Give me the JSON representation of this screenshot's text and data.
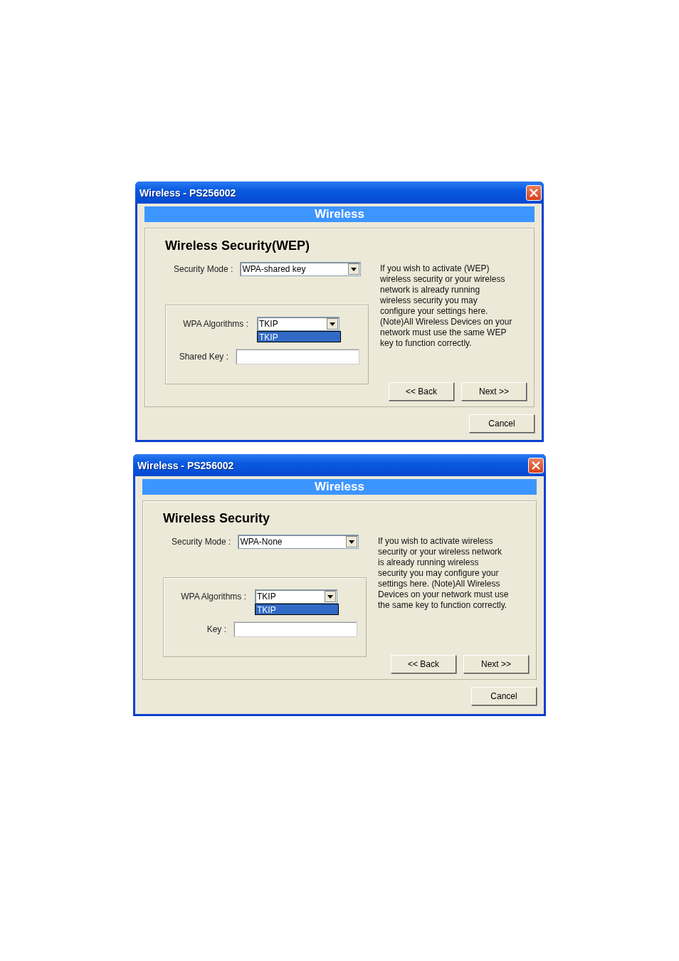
{
  "dialogs": [
    {
      "window": {
        "title": "Wireless - PS256002"
      },
      "banner": "Wireless",
      "heading": "Wireless Security(WEP)",
      "security_mode": {
        "label": "Security Mode :",
        "value": "WPA-shared key"
      },
      "algorithms": {
        "label": "WPA Algorithms :",
        "value": "TKIP",
        "options": [
          {
            "label": "TKIP",
            "selected": true
          }
        ]
      },
      "key": {
        "label": "Shared Key :"
      },
      "description": "If you wish to activate (WEP) wireless security or your wireless network is already running wireless security you may configure your settings here. (Note)All Wireless Devices on your network must use the same WEP key to function correctly.",
      "buttons": [
        "<< Back",
        "Next >>"
      ],
      "cancel": "Cancel"
    },
    {
      "window": {
        "title": "Wireless - PS256002"
      },
      "banner": "Wireless",
      "heading": "Wireless Security",
      "security_mode": {
        "label": "Security Mode :",
        "value": "WPA-None"
      },
      "algorithms": {
        "label": "WPA Algorithms :",
        "value": "TKIP",
        "options": [
          {
            "label": "TKIP",
            "selected": true
          }
        ]
      },
      "key": {
        "label": "Key :"
      },
      "description": "If you wish to activate wireless security or your wireless network is already running wireless security you may configure your settings here. (Note)All Wireless Devices on your network must use the same key to function correctly.",
      "buttons": [
        "<< Back",
        "Next >>"
      ],
      "cancel": "Cancel"
    }
  ]
}
